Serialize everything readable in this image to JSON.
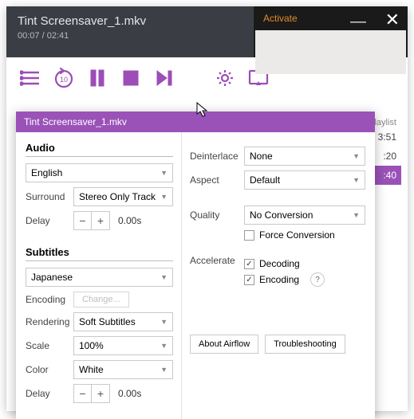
{
  "player": {
    "title": "Tint Screensaver_1.mkv",
    "current_time": "00:07",
    "duration": "02:41",
    "activate": "Activate"
  },
  "settings": {
    "title": "Tint Screensaver_1.mkv",
    "audio": {
      "heading": "Audio",
      "track": "English",
      "surround_label": "Surround",
      "surround": "Stereo Only Track",
      "delay_label": "Delay",
      "delay": "0.00s"
    },
    "subtitles": {
      "heading": "Subtitles",
      "track": "Japanese",
      "encoding_label": "Encoding",
      "change_btn": "Change...",
      "rendering_label": "Rendering",
      "rendering": "Soft Subtitles",
      "scale_label": "Scale",
      "scale": "100%",
      "color_label": "Color",
      "color": "White",
      "delay_label": "Delay",
      "delay": "0.00s"
    },
    "video": {
      "deinterlace_label": "Deinterlace",
      "deinterlace": "None",
      "aspect_label": "Aspect",
      "aspect": "Default",
      "quality_label": "Quality",
      "quality": "No Conversion",
      "force_label": "Force Conversion",
      "accelerate_label": "Accelerate",
      "decoding_label": "Decoding",
      "encoding_label": "Encoding"
    },
    "buttons": {
      "about": "About Airflow",
      "troubleshoot": "Troubleshooting"
    }
  },
  "playlist": {
    "label": "laylist",
    "times": [
      "3:51",
      ":20",
      ":40"
    ]
  }
}
